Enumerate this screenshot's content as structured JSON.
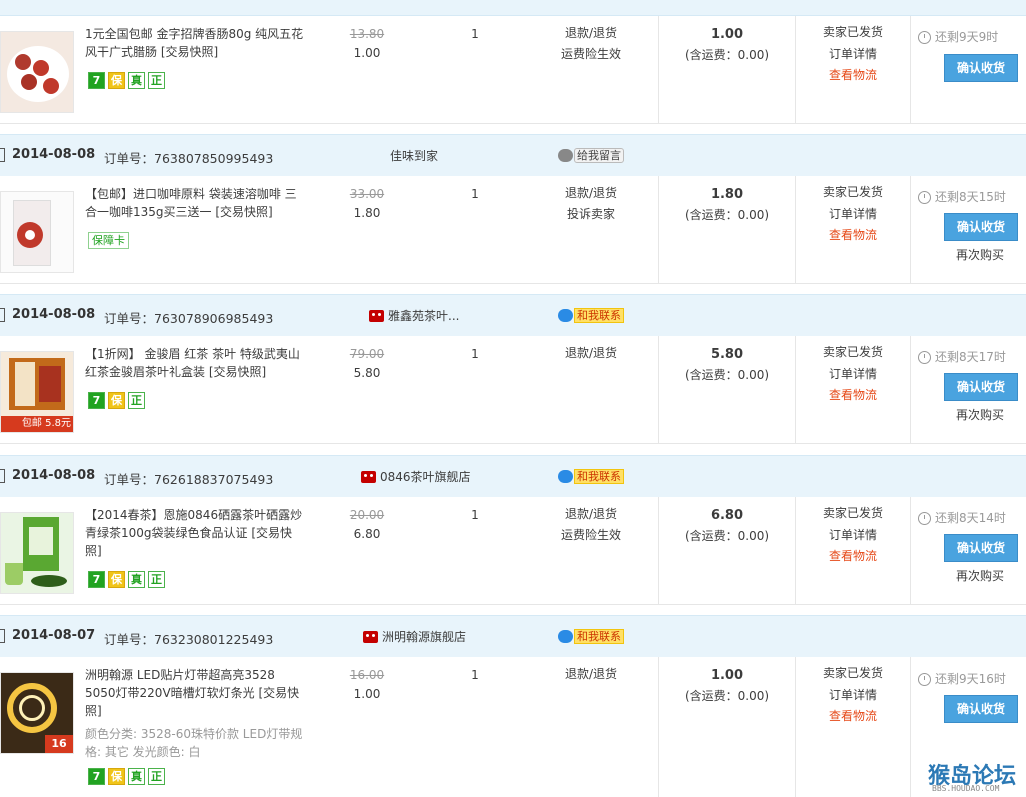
{
  "orders": [
    {
      "date": "",
      "order_label": "",
      "order_no": "",
      "shop": "",
      "title": "1元全国包邮 金字招牌香肠80g 纯风五花风干广式腊肠 [交易快照]",
      "orig_price": "13.80",
      "price": "1.00",
      "qty": "1",
      "services": [
        "退款/退货",
        "运费险生效"
      ],
      "total": "1.00",
      "shipping": "(含运费：0.00)",
      "status": [
        "卖家已发货",
        "订单详情",
        "查看物流"
      ],
      "countdown": "还剩9天9时",
      "confirm": "确认收货",
      "rebuy": "",
      "tags": [
        "7",
        "保",
        "真",
        "正"
      ],
      "thumb_colors": [
        "#f4e9e1",
        "#c0392b"
      ]
    },
    {
      "date": "2014-08-08",
      "order_label": "订单号：",
      "order_no": "763807850995493",
      "shop": "佳味到家",
      "contact": "给我留言",
      "title": "【包邮】进口咖啡原料 袋装速溶咖啡 三合一咖啡135g买三送一 [交易快照]",
      "orig_price": "33.00",
      "price": "1.80",
      "qty": "1",
      "services": [
        "退款/退货",
        "投诉卖家"
      ],
      "total": "1.80",
      "shipping": "(含运费：0.00)",
      "status": [
        "卖家已发货",
        "订单详情",
        "查看物流"
      ],
      "countdown": "还剩8天15时",
      "confirm": "确认收货",
      "rebuy": "再次购买",
      "tags": [
        "保障卡"
      ],
      "thumb_colors": [
        "#ffffff",
        "#c0392b"
      ]
    },
    {
      "date": "2014-08-08",
      "order_label": "订单号：",
      "order_no": "763078906985493",
      "shop": "雅鑫苑茶叶...",
      "contact": "和我联系",
      "title": "【1折网】 金骏眉 红茶 茶叶 特级武夷山红茶金骏眉茶叶礼盒装 [交易快照]",
      "orig_price": "79.00",
      "price": "5.80",
      "qty": "1",
      "services": [
        "退款/退货"
      ],
      "total": "5.80",
      "shipping": "(含运费：0.00)",
      "status": [
        "卖家已发货",
        "订单详情",
        "查看物流"
      ],
      "countdown": "还剩8天17时",
      "confirm": "确认收货",
      "rebuy": "再次购买",
      "tags": [
        "7",
        "保",
        "正"
      ],
      "thumb_colors": [
        "#d35400",
        "#e67e22"
      ],
      "thumb_label": "包邮 5.8元"
    },
    {
      "date": "2014-08-08",
      "order_label": "订单号：",
      "order_no": "762618837075493",
      "shop": "0846茶叶旗舰店",
      "contact": "和我联系",
      "title": "【2014春茶】恩施0846硒露茶叶硒露炒青绿茶100g袋装绿色食品认证 [交易快照]",
      "orig_price": "20.00",
      "price": "6.80",
      "qty": "1",
      "services": [
        "退款/退货",
        "运费险生效"
      ],
      "total": "6.80",
      "shipping": "(含运费：0.00)",
      "status": [
        "卖家已发货",
        "订单详情",
        "查看物流"
      ],
      "countdown": "还剩8天14时",
      "confirm": "确认收货",
      "rebuy": "再次购买",
      "tags": [
        "7",
        "保",
        "真",
        "正"
      ],
      "thumb_colors": [
        "#eaf5e4",
        "#4c9a2a"
      ]
    },
    {
      "date": "2014-08-07",
      "order_label": "订单号：",
      "order_no": "763230801225493",
      "shop": "洲明翰源旗舰店",
      "contact": "和我联系",
      "title": "洲明翰源 LED贴片灯带超高亮3528 5050灯带220V暗槽灯软灯条光 [交易快照]",
      "sku": "颜色分类: 3528-60珠特价款 LED灯带规格: 其它 发光颜色: 白",
      "orig_price": "16.00",
      "price": "1.00",
      "qty": "1",
      "services": [
        "退款/退货"
      ],
      "total": "1.00",
      "shipping": "(含运费：0.00)",
      "status": [
        "卖家已发货",
        "订单详情",
        "查看物流"
      ],
      "countdown": "还剩9天16时",
      "confirm": "确认收货",
      "rebuy": "",
      "tags": [
        "7",
        "保",
        "真",
        "正"
      ],
      "thumb_colors": [
        "#3b2a17",
        "#f5c542"
      ],
      "thumb_label": "16"
    }
  ],
  "watermark": {
    "main": "猴岛论坛",
    "sub": "BBS.HOUDAO.COM"
  }
}
